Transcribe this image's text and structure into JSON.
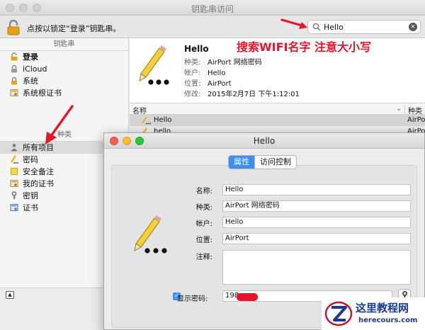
{
  "window": {
    "title": "钥匙串访问"
  },
  "toolbar": {
    "lock_text": "点按以锁定“登录”钥匙串。",
    "search_value": "Hello"
  },
  "sidebar": {
    "keychains_header": "钥匙串",
    "keychains": [
      {
        "label": "登录",
        "icon": "lock-open-icon"
      },
      {
        "label": "iCloud",
        "icon": "lock-icon"
      },
      {
        "label": "系统",
        "icon": "lock-icon"
      },
      {
        "label": "系统根证书",
        "icon": "certificate-icon"
      }
    ],
    "categories_header": "种类",
    "categories": [
      {
        "label": "所有项目",
        "icon": "people-icon"
      },
      {
        "label": "密码",
        "icon": "pencil-icon"
      },
      {
        "label": "安全备注",
        "icon": "note-icon"
      },
      {
        "label": "我的证书",
        "icon": "certificate-icon"
      },
      {
        "label": "密钥",
        "icon": "key-icon"
      },
      {
        "label": "证书",
        "icon": "certificate-icon"
      }
    ]
  },
  "detail": {
    "name": "Hello",
    "rows": [
      {
        "k": "种类:",
        "v": "AirPort 网络密码"
      },
      {
        "k": "帐户:",
        "v": "Hello"
      },
      {
        "k": "位置:",
        "v": "AirPort"
      },
      {
        "k": "修改:",
        "v": "2015年2月7日 下午1:12:01"
      }
    ]
  },
  "annotation": "搜索WIFI名字 注意大小写",
  "list": {
    "col_name": "名称",
    "col_kind": "种类",
    "rows": [
      {
        "name": "Hello",
        "kind": "AirPort"
      },
      {
        "name": "hello",
        "kind": "AirPort"
      }
    ]
  },
  "dialog": {
    "title": "Hello",
    "tabs": [
      "属性",
      "访问控制"
    ],
    "fields": {
      "name_label": "名称:",
      "name_value": "Hello",
      "kind_label": "种类:",
      "kind_value": "AirPort 网络密码",
      "account_label": "帐户:",
      "account_value": "Hello",
      "location_label": "位置:",
      "location_value": "AirPort",
      "comment_label": "注释:"
    },
    "show_password_label": "显示密码:",
    "password_value": "198"
  },
  "watermark": {
    "cn": "这里教程网",
    "en": "herecours.com"
  },
  "colors": {
    "accent": "#3d8ef7",
    "annotation_red": "#e8142a",
    "watermark_blue": "#1b3a8f"
  }
}
